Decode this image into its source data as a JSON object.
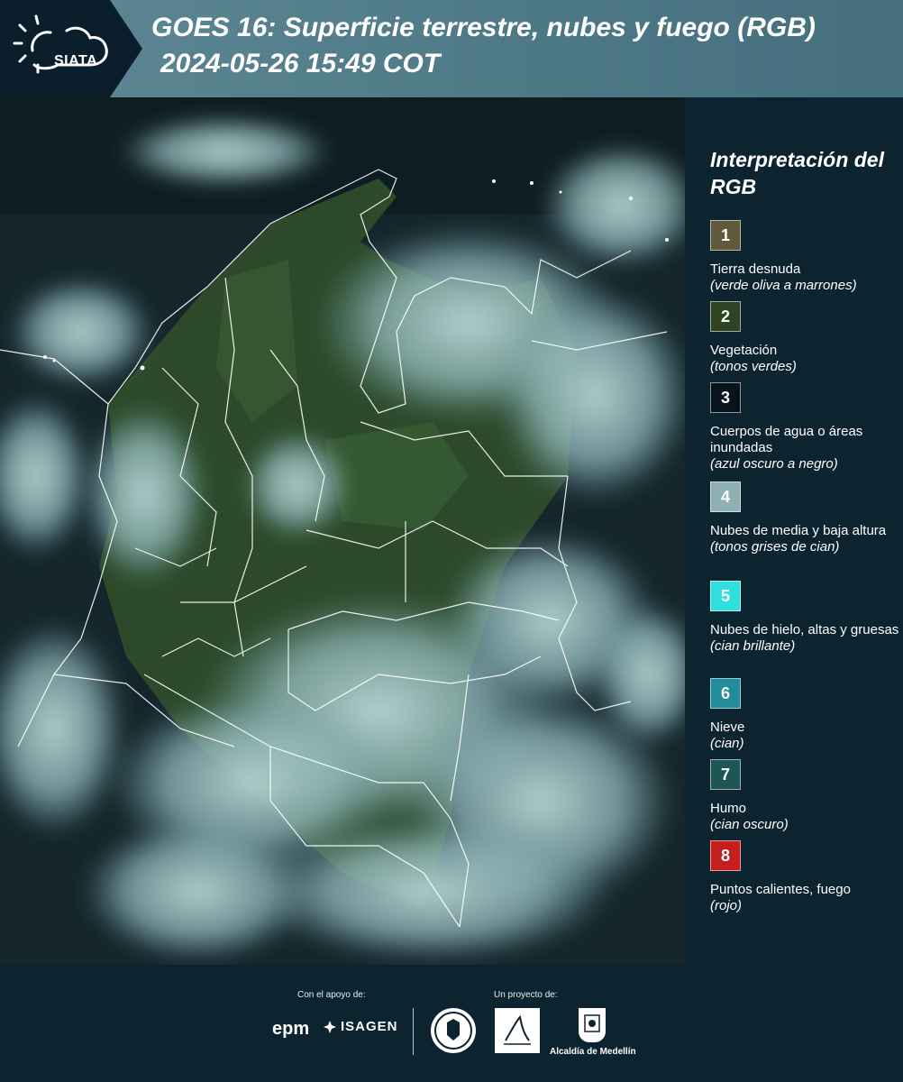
{
  "header": {
    "logo_text": "SIATA",
    "title_line1": "GOES 16: Superficie terrestre, nubes y fuego (RGB)",
    "title_line2": "2024-05-26 15:49 COT"
  },
  "legend": {
    "title": "Interpretación del RGB",
    "items": [
      {
        "number": "1",
        "label": "Tierra desnuda",
        "desc": "(verde oliva a marrones)",
        "color": "#5f5a3e"
      },
      {
        "number": "2",
        "label": "Vegetación",
        "desc": "(tonos verdes)",
        "color": "#2f4422"
      },
      {
        "number": "3",
        "label": "Cuerpos de agua o áreas inundadas",
        "desc": "(azul oscuro a negro)",
        "color": "#07141b"
      },
      {
        "number": "4",
        "label": "Nubes de media y baja altura",
        "desc": "(tonos grises de cian)",
        "color": "#8fb0b2"
      },
      {
        "number": "5",
        "label": "Nubes de hielo, altas y gruesas",
        "desc": "(cian brillante)",
        "color": "#2fe0dc"
      },
      {
        "number": "6",
        "label": "Nieve",
        "desc": "(cian)",
        "color": "#238c9c"
      },
      {
        "number": "7",
        "label": "Humo",
        "desc": "(cian oscuro)",
        "color": "#1f5555"
      },
      {
        "number": "8",
        "label": "Puntos calientes, fuego",
        "desc": "(rojo)",
        "color": "#c41e1e"
      }
    ]
  },
  "footer": {
    "support_label": "Con el apoyo de:",
    "project_label": "Un proyecto de:",
    "epm": "epm",
    "isagen": "ISAGEN",
    "alcaldia": "Alcaldía de Medellín"
  },
  "colors": {
    "background": "#0c2430",
    "header_band": "#4f7a88",
    "vegetation": "#2c4a2a",
    "cloud": "#9fc4c6",
    "border_lines": "#ffffff"
  }
}
